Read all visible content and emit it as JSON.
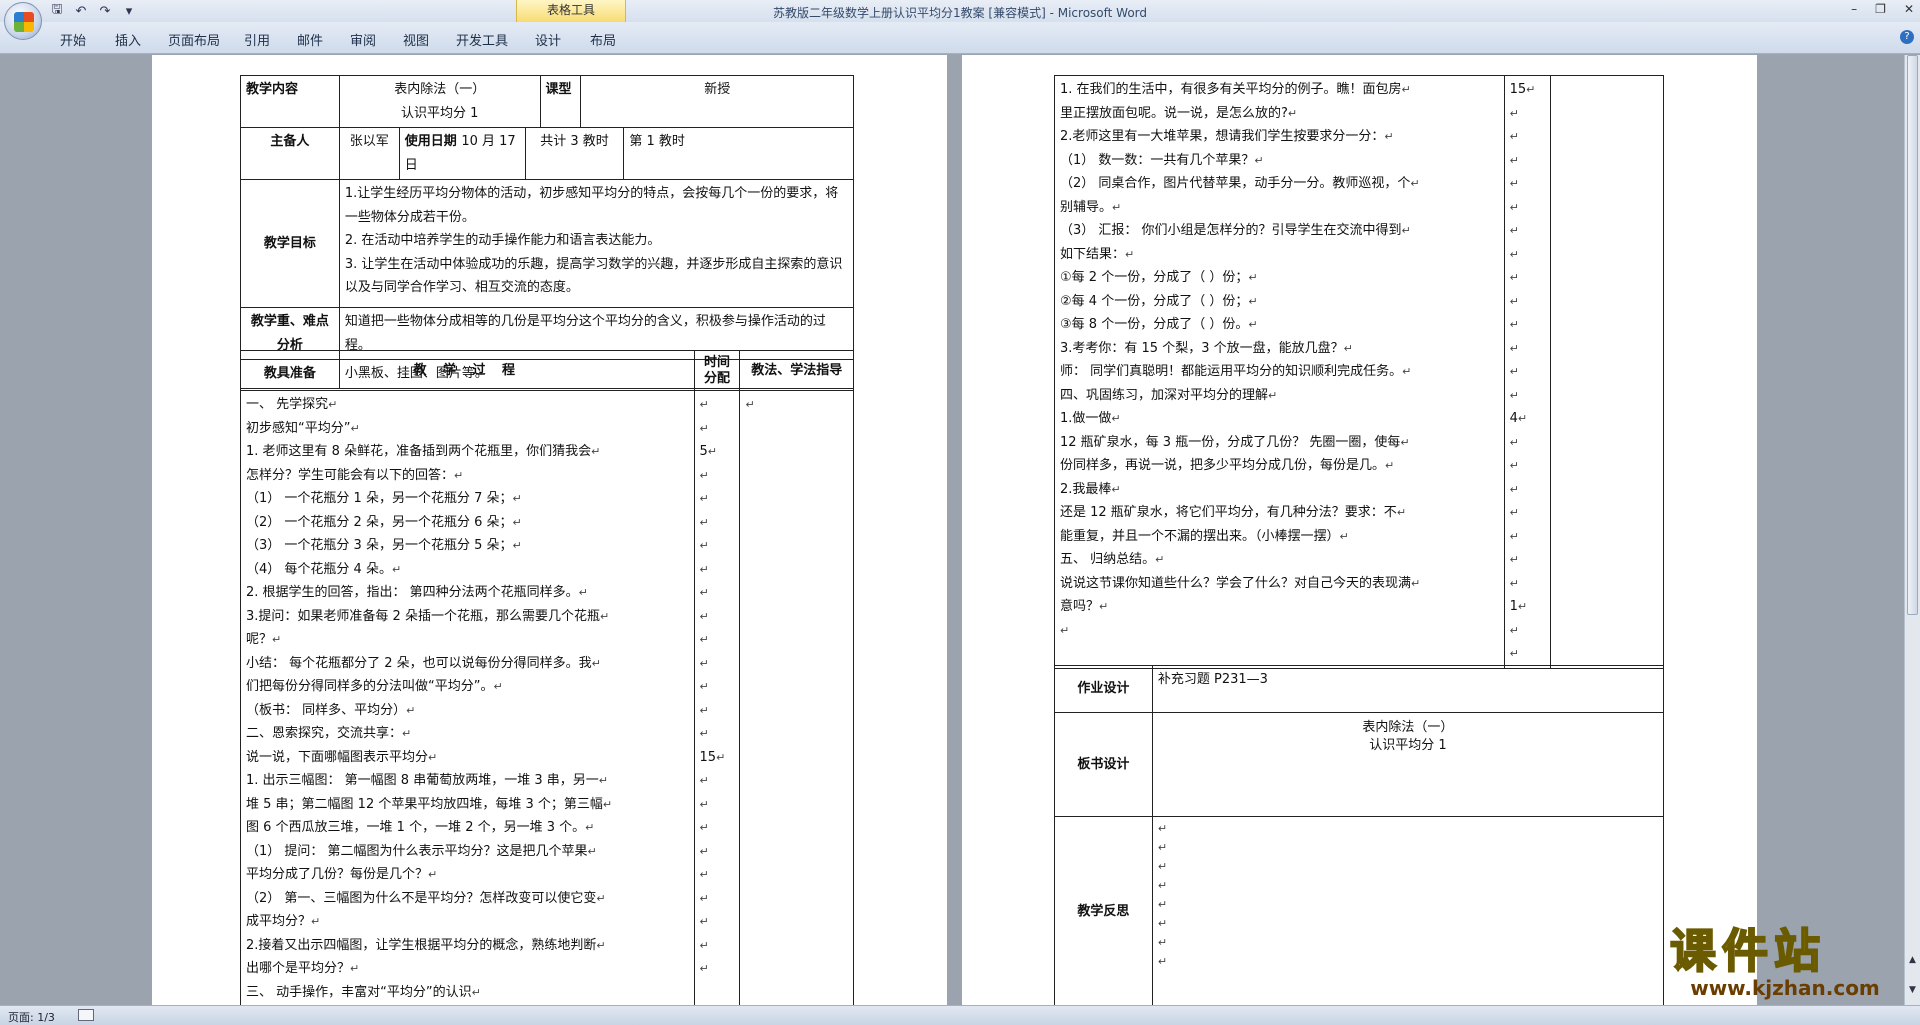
{
  "app": {
    "window_title": "苏教版二年级数学上册认识平均分1教案 [兼容模式] - Microsoft Word",
    "context_tab": "表格工具",
    "tabs": [
      "开始",
      "插入",
      "页面布局",
      "引用",
      "邮件",
      "审阅",
      "视图",
      "开发工具",
      "设计",
      "布局"
    ],
    "help": "?"
  },
  "status": {
    "page": "页面: 1/3"
  },
  "watermark": {
    "big": "课件站",
    "url": "www.kjzhan.com"
  },
  "mark": "↵",
  "page1": {
    "label_content": "教学内容",
    "topic_line1": "表内除法（一）",
    "topic_line2": "认识平均分 1",
    "label_type": "课型",
    "type_value": "新授",
    "label_preparer": "主备人",
    "preparer": "张以军",
    "label_date": "使用日期",
    "date": "10 月 17 日",
    "total": "共计 3 教时",
    "nth": "第 1 教时",
    "label_goals": "教学目标",
    "goals": [
      "1.让学生经历平均分物体的活动，初步感知平均分的特点，会按每几个一份的要求，将一些物体分成若干份。",
      "2. 在活动中培养学生的动手操作能力和语言表达能力。",
      "3. 让学生在活动中体验成功的乐趣，提高学习数学的兴趣，并逐步形成自主探索的意识以及与同学合作学习、相互交流的态度。"
    ],
    "label_key": "教学重、难点分析",
    "key_text": "知道把一些物体分成相等的几份是平均分这个平均分的含义，积极参与操作活动的过程。",
    "label_prep": "教具准备",
    "prep_text": "小黑板、挂图、图片等。",
    "head_process": "教 学 过 程",
    "head_time": "时间分配",
    "head_method": "教法、学法指导",
    "process": [
      "一、 先学探究",
      "初步感知“平均分”",
      "1. 老师这里有 8 朵鲜花，准备插到两个花瓶里，你们猜我会",
      "怎样分？学生可能会有以下的回答：",
      "（1） 一个花瓶分 1 朵，另一个花瓶分 7 朵；",
      "（2） 一个花瓶分 2 朵，另一个花瓶分 6 朵；",
      "（3） 一个花瓶分 3 朵，另一个花瓶分 5 朵；",
      "（4） 每个花瓶分 4 朵。",
      "2. 根据学生的回答，指出： 第四种分法两个花瓶同样多。",
      "3.提问：如果老师准备每 2 朵插一个花瓶，那么需要几个花瓶",
      "呢？",
      " 小结： 每个花瓶都分了 2 朵，也可以说每份分得同样多。我",
      "们把每份分得同样多的分法叫做“平均分”。",
      "（板书： 同样多、平均分）",
      "二、恩索探究，交流共享：",
      " 说一说，下面哪幅图表示平均分",
      "1. 出示三幅图： 第一幅图 8 串葡萄放两堆，一堆 3 串，另一",
      "堆 5 串；第二幅图 12 个苹果平均放四堆，每堆 3 个；第三幅",
      "图 6 个西瓜放三堆，一堆 1 个，一堆 2 个，另一堆 3 个。",
      "（1） 提问： 第二幅图为什么表示平均分？这是把几个苹果",
      "平均分成了几份？每份是几个？",
      "（2） 第一、三幅图为什么不是平均分？怎样改变可以使它变",
      "成平均分？",
      "2.接着又出示四幅图，让学生根据平均分的概念，熟练地判断",
      "出哪个是平均分？",
      "三、 动手操作，丰富对“平均分”的认识"
    ],
    "times": [
      "",
      "",
      "5",
      "",
      "",
      "",
      "",
      "",
      "",
      "",
      "",
      "",
      "",
      "",
      "",
      "15",
      "",
      "",
      "",
      "",
      "",
      "",
      "",
      "",
      ""
    ]
  },
  "page2": {
    "process": [
      "1. 在我们的生活中，有很多有关平均分的例子。瞧！面包房",
      "里正摆放面包呢。说一说，是怎么放的?",
      "2.老师这里有一大堆苹果，想请我们学生按要求分一分：",
      "（1） 数一数：一共有几个苹果？",
      "（2） 同桌合作，图片代替苹果，动手分一分。教师巡视，个",
      "别辅导。",
      "（3） 汇报： 你们小组是怎样分的？引导学生在交流中得到",
      "如下结果：",
      "①每 2 个一份，分成了（      ）份；",
      "②每 4 个一份，分成了（      ）份；",
      "③每 8 个一份，分成了（      ）份。",
      "3.考考你：有 15 个梨，3 个放一盘，能放几盘？",
      "师： 同学们真聪明！都能运用平均分的知识顺利完成任务。",
      "四、巩固练习，加深对平均分的理解",
      "1.做一做",
      "  12 瓶矿泉水，每 3 瓶一份，分成了几份？ 先圈一圈，使每",
      "份同样多，再说一说，把多少平均分成几份，每份是几。",
      "2.我最棒",
      "  还是 12 瓶矿泉水，将它们平均分，有几种分法？要求：不",
      "能重复，并且一个不漏的摆出来。（小棒摆一摆）",
      "五、 归纳总结。",
      "说说这节课你知道些什么？学会了什么？对自己今天的表现满",
      "意吗？",
      ""
    ],
    "times": [
      "15",
      "",
      "",
      "",
      "",
      "",
      "",
      "",
      "",
      "",
      "",
      "",
      "",
      "",
      "4",
      "",
      "",
      "",
      "",
      "",
      "",
      "",
      "1",
      "",
      ""
    ],
    "label_homework": "作业设计",
    "homework": "补充习题 P231—3",
    "label_board": "板书设计",
    "board_line1": "表内除法（一）",
    "board_line2": "认识平均分 1",
    "label_reflect": "教学反思"
  }
}
